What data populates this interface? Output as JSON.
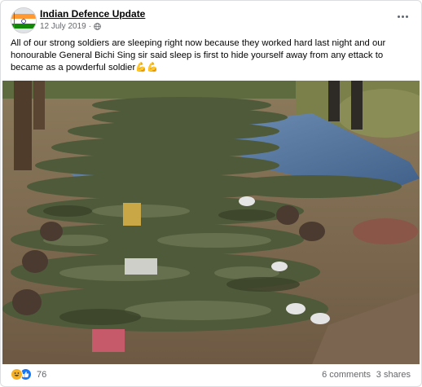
{
  "post": {
    "page_name": "Indian Defence Update",
    "date": "12 July 2019",
    "separator": "·",
    "audience_icon": "globe-icon",
    "more_icon": "more-options-icon",
    "text": "All of our strong soldiers are sleeping right now because they worked hard last night and our honourable General Bichi Sing sir said sleep is first to hide yourself away from any ettack to became as a powderful soldier",
    "text_emoji": "💪💪",
    "photo_alt": "photo-of-soldiers-lying-on-ground"
  },
  "footer": {
    "reaction_icons": [
      "haha-reaction-icon",
      "like-reaction-icon"
    ],
    "reaction_count": "76",
    "comments": "6 comments",
    "shares": "3 shares"
  },
  "colors": {
    "secondary_text": "#65676b",
    "like_blue": "#1877f2",
    "haha_yellow": "#f7b125",
    "flag_saffron": "#ff9933",
    "flag_green": "#138808"
  }
}
